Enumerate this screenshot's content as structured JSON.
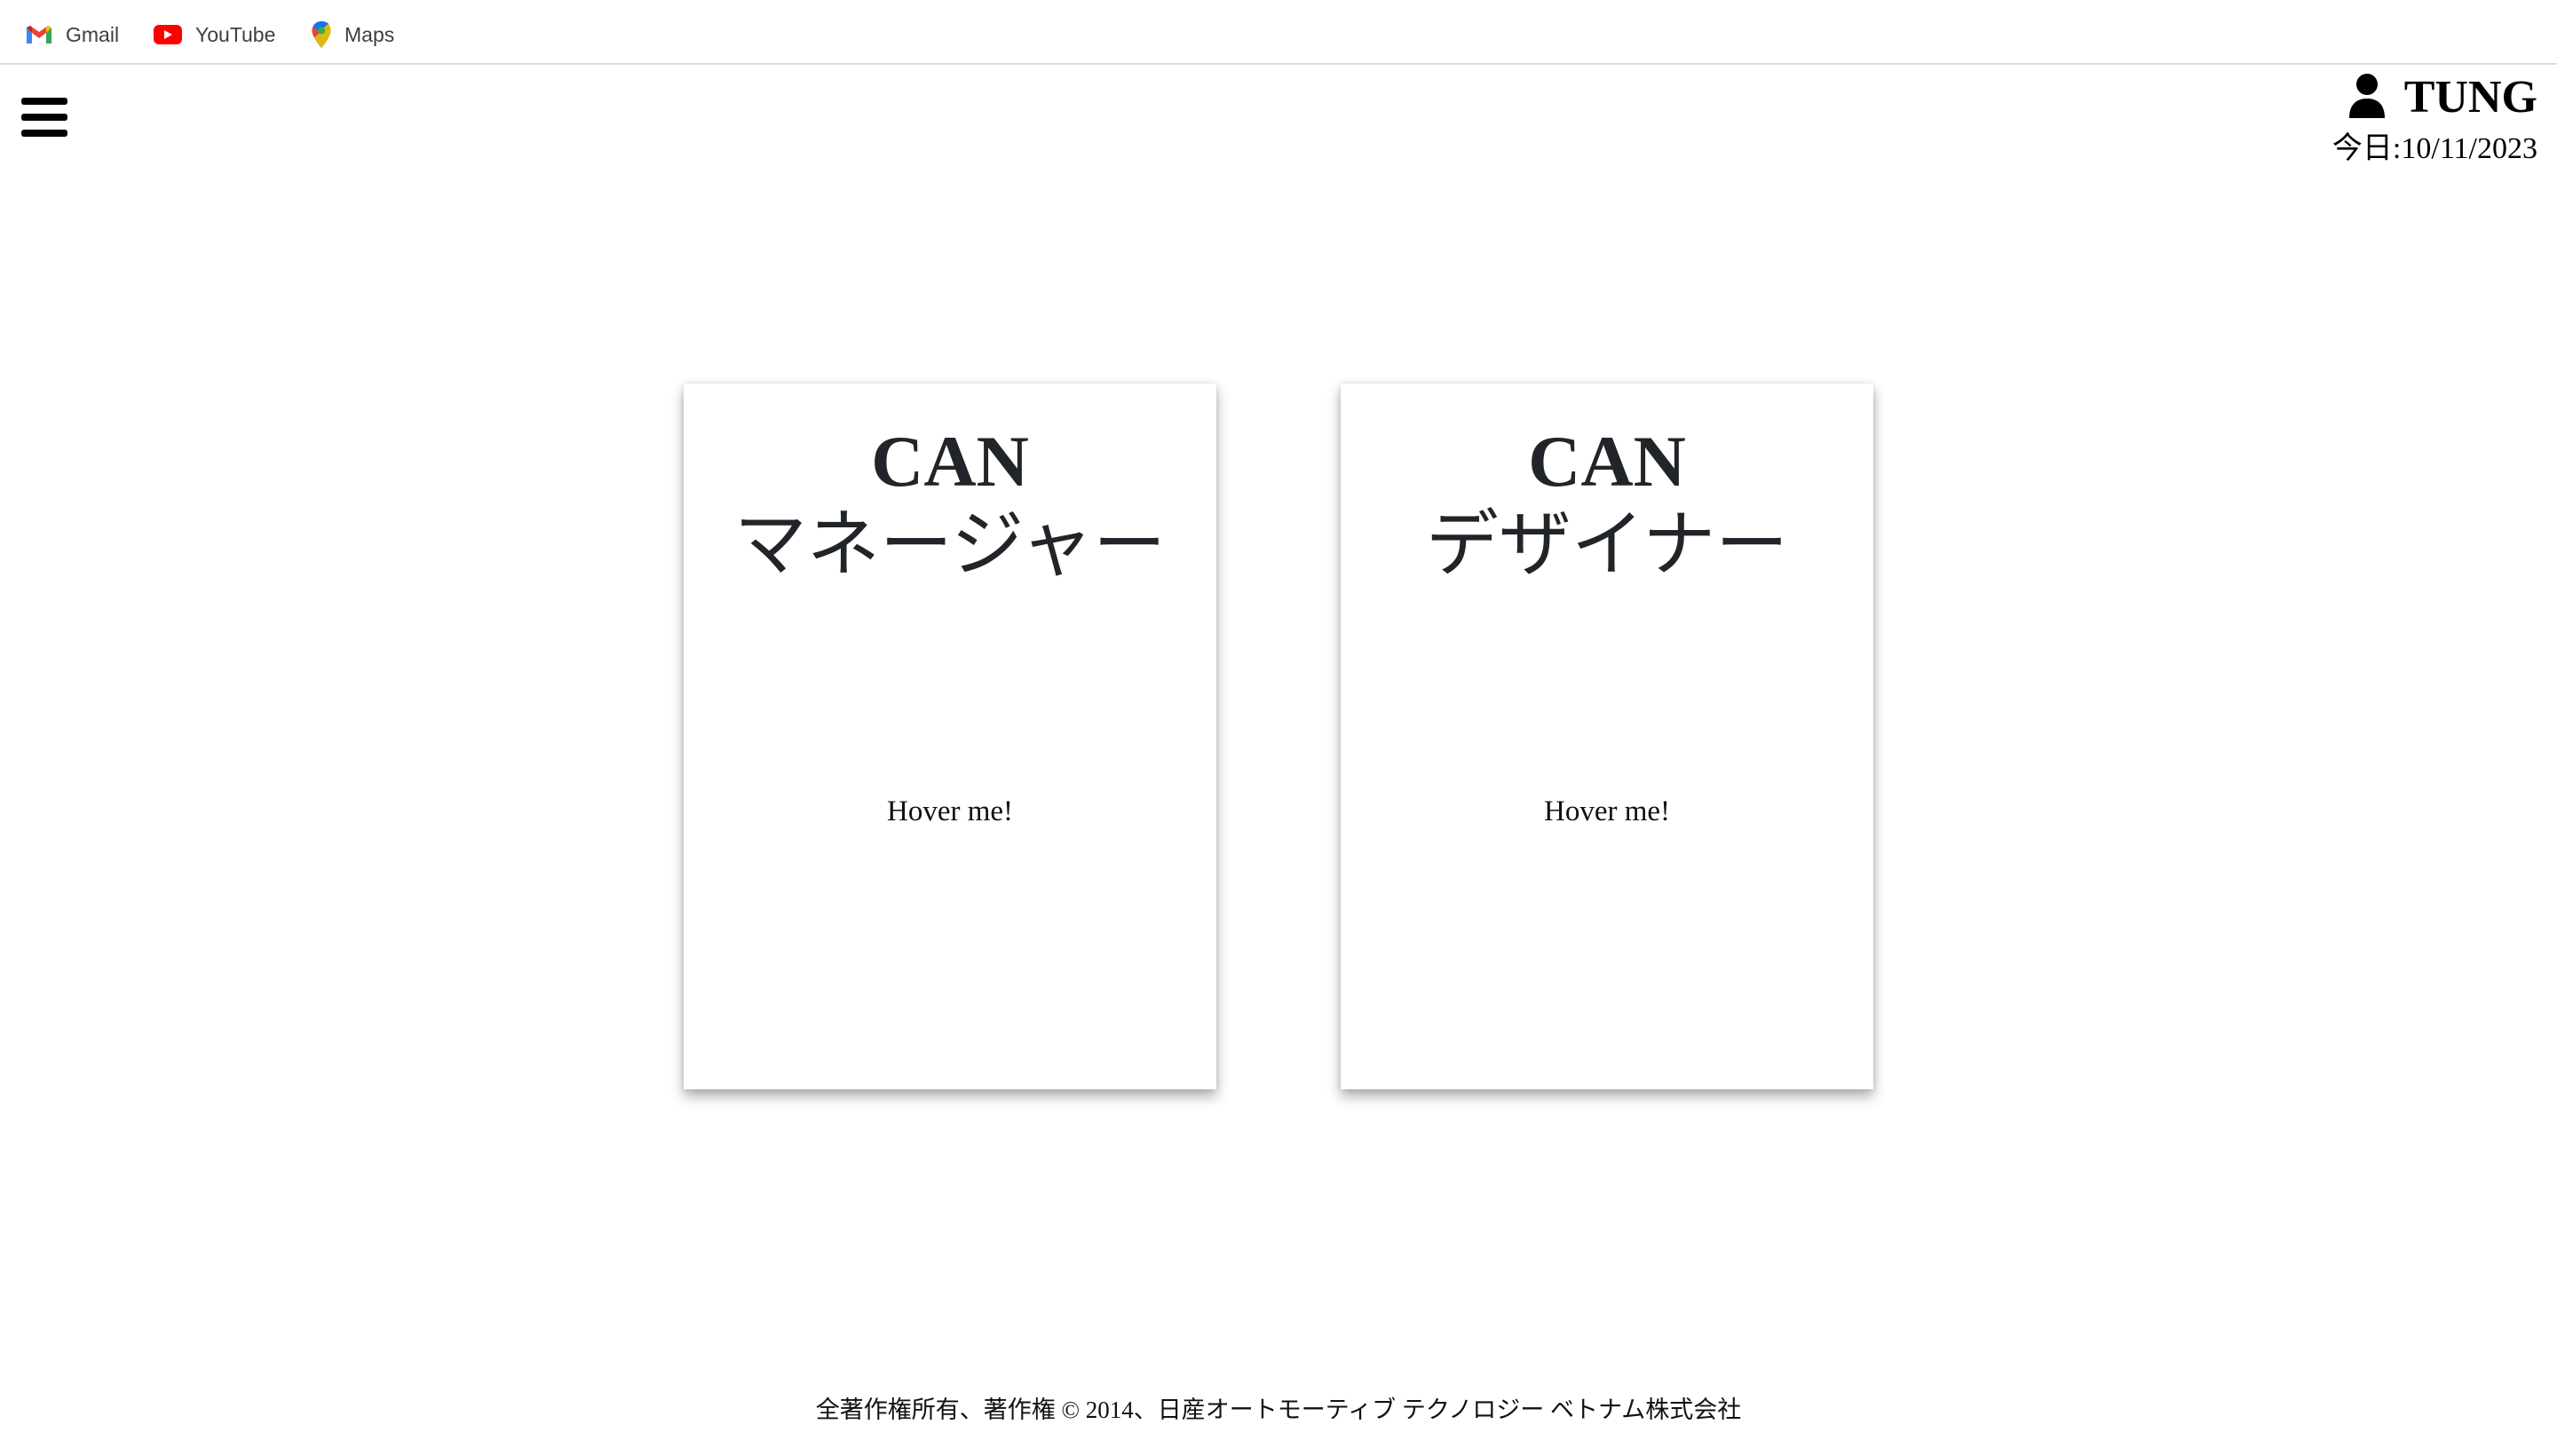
{
  "bookmarks": [
    {
      "label": "Gmail",
      "icon": "gmail-icon"
    },
    {
      "label": "YouTube",
      "icon": "youtube-icon"
    },
    {
      "label": "Maps",
      "icon": "maps-icon"
    }
  ],
  "header": {
    "menu_icon": "hamburger-menu-icon",
    "user": {
      "icon": "user-icon",
      "name": "TUNG"
    },
    "date_text": "今日:10/11/2023"
  },
  "cards": [
    {
      "title": "CAN",
      "subtitle": "マネージャー",
      "hover_text": "Hover me!"
    },
    {
      "title": "CAN",
      "subtitle": "デザイナー",
      "hover_text": "Hover me!"
    }
  ],
  "footer": {
    "text": "全著作権所有、著作権 © 2014、日産オートモーティブ テクノロジー ベトナム株式会社"
  },
  "colors": {
    "gmail_red": "#EA4335",
    "youtube_red": "#FF0000",
    "text_dark": "#212529",
    "bar_border": "#dadce0"
  }
}
